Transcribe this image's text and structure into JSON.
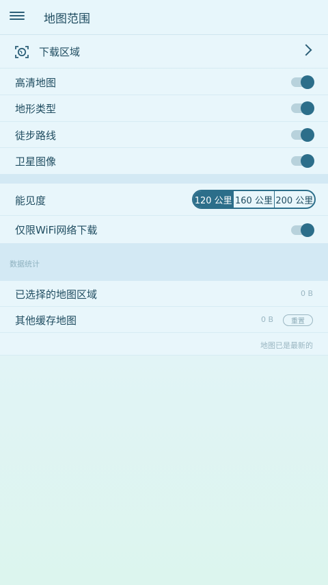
{
  "header": {
    "title": "地图范围",
    "menu_icon": "hamburger-menu-icon"
  },
  "download_area": {
    "label": "下载区域",
    "icon": "globe-scan-icon",
    "chevron_icon": "chevron-right-icon"
  },
  "layers": [
    {
      "label": "高清地图",
      "enabled": true
    },
    {
      "label": "地形类型",
      "enabled": true
    },
    {
      "label": "徒步路线",
      "enabled": true
    },
    {
      "label": "卫星图像",
      "enabled": true
    }
  ],
  "visibility": {
    "label": "能见度",
    "options": [
      "120 公里",
      "160 公里",
      "200 公里"
    ],
    "selected": "120 公里"
  },
  "wifi_only": {
    "label": "仅限WiFi网络下载",
    "enabled": true
  },
  "stats": {
    "section_label": "数据统计",
    "selected_area": {
      "label": "已选择的地图区域",
      "size": "0 B"
    },
    "other_cache": {
      "label": "其他缓存地图",
      "size": "0 B",
      "reset_label": "重置"
    },
    "status": "地图已是最新的"
  },
  "colors": {
    "accent": "#2c6e8a",
    "background": "#e8f6fb",
    "section_band": "#d3e9f4"
  }
}
